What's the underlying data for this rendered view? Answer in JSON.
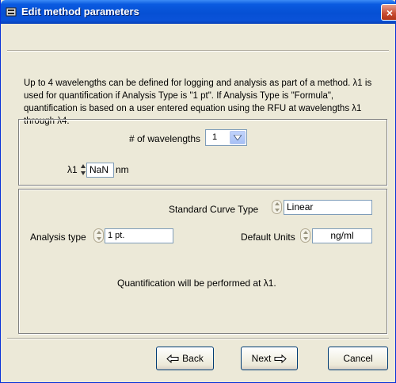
{
  "window": {
    "title": "Edit method parameters",
    "close_label": "×"
  },
  "description": "Up to 4 wavelengths can be defined for logging and analysis as part of a method.  λ1 is used for quantification if Analysis Type is \"1 pt\". If Analysis Type is \"Formula\", quantification is based on a user entered equation using the RFU at wavelengths λ1 through λ4.",
  "wavelengths": {
    "count_label": "# of wavelengths",
    "count_value": "1",
    "lambda_label": "λ1",
    "lambda_value": "NaN",
    "unit": "nm"
  },
  "analysis": {
    "curve_type_label": "Standard Curve Type",
    "curve_type_value": "Linear",
    "analysis_type_label": "Analysis type",
    "analysis_type_value": "1 pt.",
    "default_units_label": "Default Units",
    "default_units_value": "ng/ml",
    "note": "Quantification will be performed at λ1."
  },
  "buttons": {
    "back_label": "Back",
    "next_label": "Next",
    "cancel_label": "Cancel"
  },
  "icons": [
    "window-icon",
    "close-icon",
    "dropdown-arrow-icon",
    "spinner-icon",
    "back-arrow-icon",
    "next-arrow-icon"
  ],
  "colors": {
    "titlebar": "#0650d4",
    "window_bg": "#ece9d8",
    "field_border": "#7f9db9",
    "button_border": "#003c74"
  }
}
